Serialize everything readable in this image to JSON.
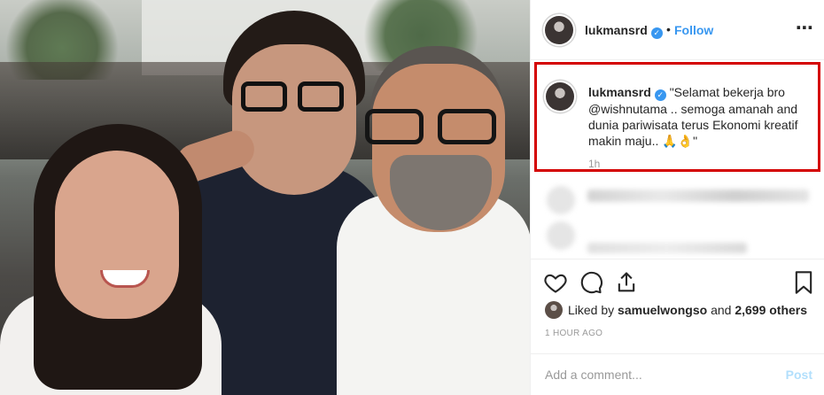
{
  "header": {
    "username": "lukmansrd",
    "separator": "•",
    "follow_label": "Follow",
    "more_icon": "⋯"
  },
  "caption": {
    "username": "lukmansrd",
    "text": "\"Selamat bekerja bro @wishnutama .. semoga amanah and dunia pariwisata terus Ekonomi kreatif makin maju..",
    "emoji": "🙏👌",
    "text_end": "\"",
    "time": "1h"
  },
  "likes": {
    "prefix": "Liked by",
    "user": "samuelwongso",
    "middle": "and",
    "count": "2,699 others"
  },
  "timestamp": "1 HOUR AGO",
  "comment": {
    "placeholder": "Add a comment...",
    "post_label": "Post"
  },
  "colors": {
    "link": "#3897f0",
    "highlight_border": "#d40000",
    "post_disabled": "#b2dffc"
  }
}
